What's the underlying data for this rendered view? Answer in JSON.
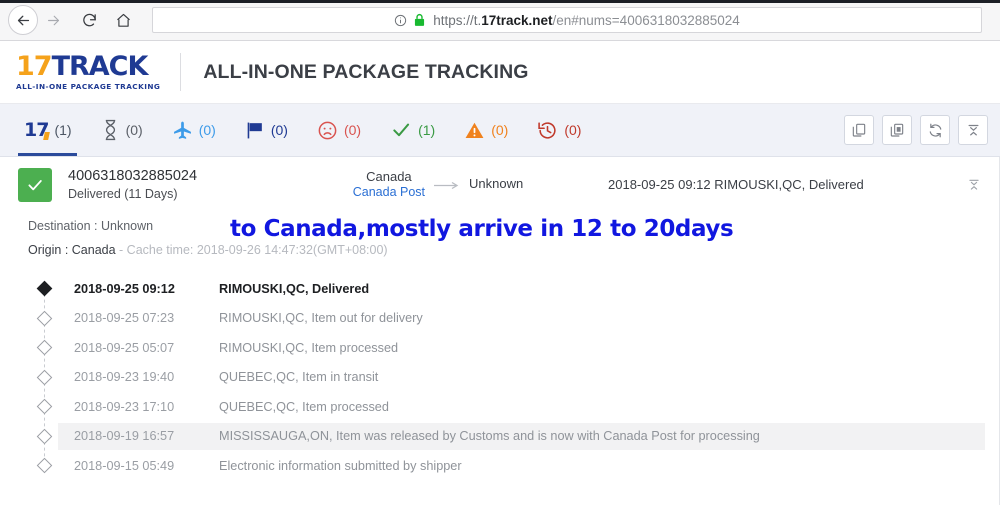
{
  "browser": {
    "back_label": "Back",
    "forward_label": "Forward",
    "reload_label": "Reload",
    "home_label": "Home",
    "url": {
      "scheme": "https://t.",
      "host": "17track.net",
      "path": "/en#nums=4006318032885024",
      "full": "https://t.17track.net/en#nums=4006318032885024"
    },
    "site_info_label": "Site information",
    "secure_label": "Secure"
  },
  "header": {
    "logo_17": "17",
    "logo_track": "TRACK",
    "logo_tagline": "ALL-IN-ONE PACKAGE TRACKING",
    "title": "ALL-IN-ONE PACKAGE TRACKING"
  },
  "tabs": [
    {
      "id": "all",
      "icon": "17-logo-icon",
      "glyph": "17",
      "count": "(1)",
      "color": "#1f3a93",
      "active": true
    },
    {
      "id": "pending",
      "icon": "hourglass-icon",
      "glyph": "",
      "count": "(0)",
      "color": "#5b6068",
      "active": false
    },
    {
      "id": "in-transit",
      "icon": "airplane-icon",
      "glyph": "",
      "count": "(0)",
      "color": "#3d9be9",
      "active": false
    },
    {
      "id": "arrived",
      "icon": "flag-icon",
      "glyph": "",
      "count": "(0)",
      "color": "#1f3a93",
      "active": false
    },
    {
      "id": "exception",
      "icon": "sad-face-icon",
      "glyph": "",
      "count": "(0)",
      "color": "#d9534f",
      "active": false
    },
    {
      "id": "delivered",
      "icon": "check-icon",
      "glyph": "",
      "count": "(1)",
      "color": "#3a9a44",
      "active": false
    },
    {
      "id": "alert",
      "icon": "warning-triangle-icon",
      "glyph": "",
      "count": "(0)",
      "color": "#f0821e",
      "active": false
    },
    {
      "id": "expired",
      "icon": "clock-history-icon",
      "glyph": "",
      "count": "(0)",
      "color": "#c0392b",
      "active": false
    }
  ],
  "toolbar": [
    {
      "id": "copy",
      "icon": "copy-icon",
      "label": "Copy"
    },
    {
      "id": "delete",
      "icon": "delete-icon",
      "label": "Delete"
    },
    {
      "id": "refresh",
      "icon": "refresh-icon",
      "label": "Refresh"
    },
    {
      "id": "collapse",
      "icon": "collapse-icon",
      "label": "Collapse all"
    }
  ],
  "result": {
    "status_icon": "check-icon",
    "status_color": "#4caf50",
    "tracking_number": "4006318032885024",
    "status_text": "Delivered (11 Days)",
    "origin_country": "Canada",
    "carrier": "Canada Post",
    "arrow_icon": "arrow-right-icon",
    "destination_country": "Unknown",
    "last_event": "2018-09-25 09:12  RIMOUSKI,QC, Delivered",
    "collapse_icon": "collapse-icon"
  },
  "meta": {
    "destination_label": "Destination : ",
    "destination_value": "Unknown",
    "origin_label": "Origin : ",
    "origin_value": "Canada",
    "cache_text": " - Cache time: 2018-09-26 14:47:32(GMT+08:00)",
    "annotation": "to Canada,mostly arrive in 12 to 20days",
    "annotation_color": "#1117e0"
  },
  "events": [
    {
      "time": "2018-09-25 09:12",
      "desc": "RIMOUSKI,QC, Delivered",
      "current": true,
      "highlight": false
    },
    {
      "time": "2018-09-25 07:23",
      "desc": "RIMOUSKI,QC, Item out for delivery",
      "current": false,
      "highlight": false
    },
    {
      "time": "2018-09-25 05:07",
      "desc": "RIMOUSKI,QC, Item processed",
      "current": false,
      "highlight": false
    },
    {
      "time": "2018-09-23 19:40",
      "desc": "QUEBEC,QC, Item in transit",
      "current": false,
      "highlight": false
    },
    {
      "time": "2018-09-23 17:10",
      "desc": "QUEBEC,QC, Item processed",
      "current": false,
      "highlight": false
    },
    {
      "time": "2018-09-19 16:57",
      "desc": "MISSISSAUGA,ON, Item was released by Customs and is now with Canada Post for processing",
      "current": false,
      "highlight": true
    },
    {
      "time": "2018-09-15 05:49",
      "desc": "Electronic information submitted by shipper",
      "current": false,
      "highlight": false
    }
  ]
}
